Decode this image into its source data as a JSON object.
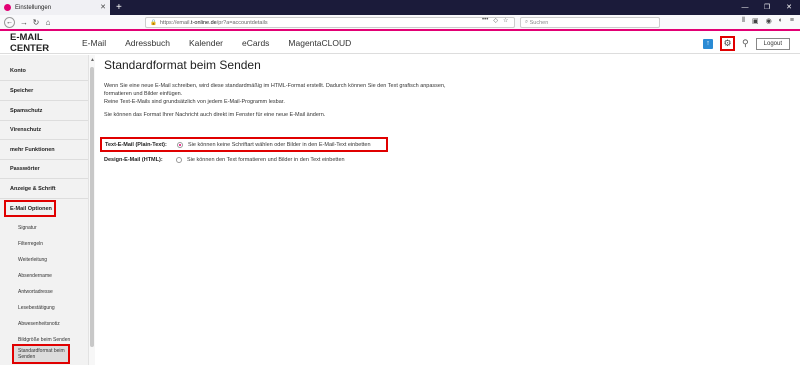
{
  "browser": {
    "tab_title": "Einstellungen",
    "url_prefix": "https://email.",
    "url_host": "t-online.de",
    "url_path": "/pr?a=accountdetails",
    "search_placeholder": "Suchen"
  },
  "header": {
    "brand": "E-MAIL CENTER",
    "nav": [
      "E-Mail",
      "Adressbuch",
      "Kalender",
      "eCards",
      "MagentaCLOUD"
    ],
    "logout": "Logout"
  },
  "sidebar": {
    "items": [
      "Konto",
      "Speicher",
      "Spamschutz",
      "Virenschutz",
      "mehr Funktionen",
      "Passwörter",
      "Anzeige & Schrift",
      "E-Mail Optionen"
    ],
    "subitems": [
      "Signatur",
      "Filterregeln",
      "Weiterleitung",
      "Absendername",
      "Antwortadresse",
      "Lesebestätigung",
      "Abwesenheitsnotiz",
      "Bildgröße beim Senden",
      "Standardformat beim Senden"
    ]
  },
  "main": {
    "title": "Standardformat beim Senden",
    "desc_line1": "Wenn Sie eine neue E-Mail schreiben, wird diese standardmäßig im HTML-Format erstellt. Dadurch können Sie den Text grafisch anpassen, formatieren und Bilder einfügen.",
    "desc_line2": "Reine Text-E-Mails sind grundsätzlich von jedem E-Mail-Programm lesbar.",
    "desc_line3": "Sie können das Format Ihrer Nachricht auch direkt im Fenster für eine neue E-Mail ändern.",
    "options": [
      {
        "label": "Text-E-Mail (Plain-Text):",
        "text": "Sie können keine Schriftart wählen oder Bilder in den E-Mail-Text einbetten",
        "selected": true
      },
      {
        "label": "Design-E-Mail (HTML):",
        "text": "Sie können den Text formatieren und Bilder in den Text einbetten",
        "selected": false
      }
    ]
  },
  "colors": {
    "accent": "#e20074",
    "highlight": "#e00000"
  }
}
